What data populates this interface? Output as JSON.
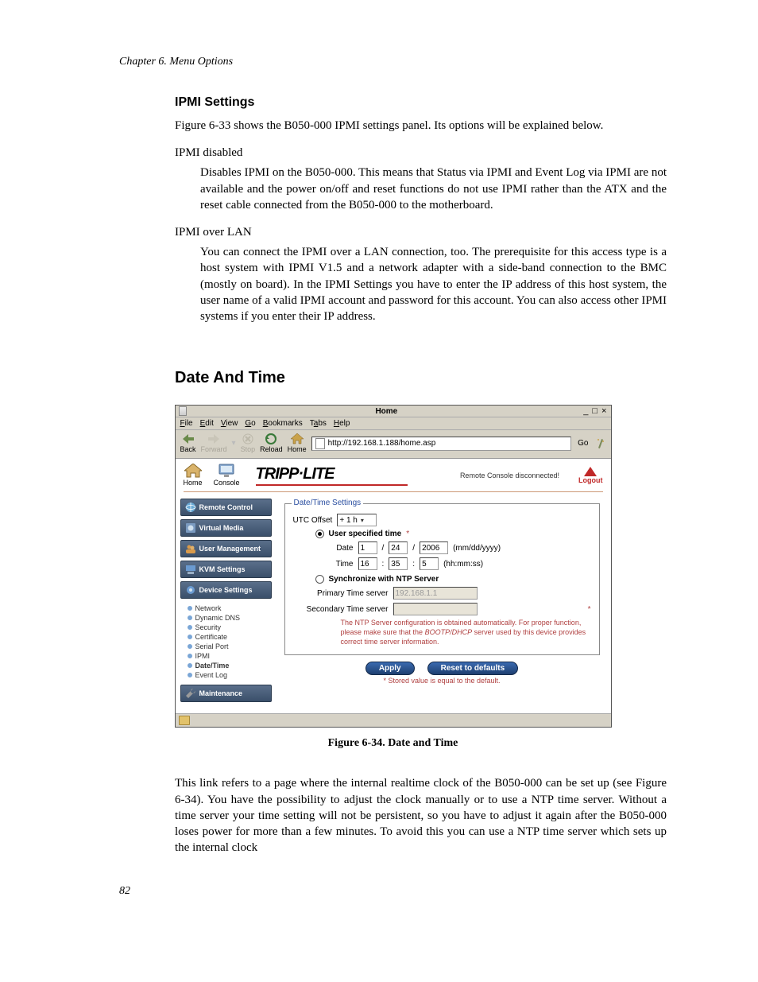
{
  "chapter_header": "Chapter 6. Menu Options",
  "s1": {
    "title": "IPMI Settings",
    "para1": "Figure 6-33 shows the B050-000 IPMI settings panel. Its options will be explained below.",
    "term1": "IPMI disabled",
    "def1": "Disables IPMI on the B050-000. This means that Status via IPMI and Event Log via IPMI are not available and the power on/off and reset functions do not use IPMI rather than the ATX and the reset cable connected from the B050-000 to the motherboard.",
    "term2": "IPMI over LAN",
    "def2": "You can connect the IPMI over a LAN connection, too. The prerequisite for this access type is a host system with IPMI V1.5 and a network adapter with a side-band connection to the BMC (mostly on board). In the IPMI Settings you have to enter the IP address of this host system, the user name of a valid IPMI account and password for this account. You can also access other IPMI systems if you enter their IP address."
  },
  "s2": {
    "title": "Date And Time",
    "caption": "Figure 6-34. Date and Time",
    "para1": "This link refers to a page where the internal realtime clock of the B050-000 can be set up (see Figure 6-34). You have the possibility to adjust the clock manually or to use a NTP time server. Without a time server your time setting will not be persistent, so you have to adjust it again after the B050-000 loses power for more than a few minutes. To avoid this you can use a NTP time server which sets up the internal clock"
  },
  "page_number": "82",
  "window": {
    "title": "Home",
    "controls": "_ □ ×",
    "menus": {
      "file": "File",
      "edit": "Edit",
      "view": "View",
      "go": "Go",
      "bookmarks": "Bookmarks",
      "tabs": "Tabs",
      "help": "Help"
    },
    "toolbar": {
      "back": "Back",
      "forward": "Forward",
      "stop": "Stop",
      "reload": "Reload",
      "home": "Home",
      "go": "Go"
    },
    "url": "http://192.168.1.188/home.asp",
    "strip": {
      "home": "Home",
      "console": "Console",
      "logo": "TRIPP·LITE",
      "status": "Remote Console disconnected!",
      "logout": "Logout"
    },
    "sidebar": {
      "items": [
        "Remote Control",
        "Virtual Media",
        "User Management",
        "KVM Settings",
        "Device Settings",
        "Maintenance"
      ],
      "subs": [
        "Network",
        "Dynamic DNS",
        "Security",
        "Certificate",
        "Serial Port",
        "IPMI",
        "Date/Time",
        "Event Log"
      ]
    },
    "panel": {
      "legend": "Date/Time Settings",
      "utc_label": "UTC Offset",
      "utc_value": "+ 1 h",
      "opt_user": "User specified time",
      "date_label": "Date",
      "date_m": "1",
      "date_d": "24",
      "date_y": "2006",
      "date_fmt": "(mm/dd/yyyy)",
      "time_label": "Time",
      "time_h": "16",
      "time_m": "35",
      "time_s": "5",
      "time_fmt": "(hh:mm:ss)",
      "opt_ntp": "Synchronize with NTP Server",
      "primary_label": "Primary Time server",
      "primary_value": "192.168.1.1",
      "secondary_label": "Secondary Time server",
      "secondary_value": "",
      "note": "The NTP Server configuration is obtained automatically. For proper function, please make sure that the BOOTP/DHCP server used by this device provides correct time server information.",
      "note_italic": "BOOTP/DHCP",
      "apply": "Apply",
      "reset": "Reset to defaults",
      "stored": "* Stored value is equal to the default."
    }
  }
}
